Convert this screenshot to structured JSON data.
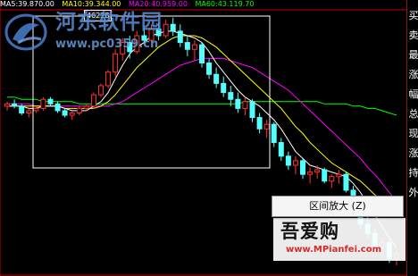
{
  "ma_header": {
    "items": [
      {
        "text": "MA5:39.870.00",
        "color": "#ffffff"
      },
      {
        "text": "MA10:39.344.00",
        "color": "#ffff00"
      },
      {
        "text": "MA20:40.959.00",
        "color": "#ff00ff"
      },
      {
        "text": "MA60:43.119.70",
        "color": "#00ff00"
      }
    ]
  },
  "selection_value": "46228",
  "right_panel": {
    "items": [
      "买",
      "卖",
      "最",
      "涨",
      "幅",
      "总",
      "现",
      "涨",
      "持",
      "外"
    ]
  },
  "context_menu": {
    "item_label": "区间放大 (Z)"
  },
  "watermarks": {
    "top_title": "河东软件园",
    "top_url": "www.pc0359.cn",
    "bottom_brand": "吾爱购",
    "bottom_url": "www.MPianfei.com"
  },
  "colors": {
    "background": "#000000",
    "up_candle": "#ff3232",
    "down_candle": "#54ffff",
    "ma5": "#ffffff",
    "ma10": "#ffff00",
    "ma20": "#ff00ff",
    "ma60": "#00ff00",
    "selection_box": "#ffffff",
    "separator": "#c00000"
  },
  "chart_data": {
    "type": "candlestick",
    "candles": [
      [
        100,
        102,
        98,
        101
      ],
      [
        101,
        103,
        99,
        100
      ],
      [
        100,
        101,
        96,
        97
      ],
      [
        97,
        99,
        95,
        98
      ],
      [
        98,
        100,
        97,
        99
      ],
      [
        99,
        104,
        98,
        103
      ],
      [
        103,
        104,
        100,
        101
      ],
      [
        101,
        102,
        97,
        98
      ],
      [
        98,
        99,
        95,
        96
      ],
      [
        96,
        98,
        94,
        97
      ],
      [
        97,
        100,
        96,
        99
      ],
      [
        99,
        101,
        98,
        100
      ],
      [
        100,
        106,
        99,
        105
      ],
      [
        105,
        110,
        104,
        109
      ],
      [
        109,
        116,
        108,
        115
      ],
      [
        115,
        125,
        113,
        123
      ],
      [
        123,
        130,
        120,
        128
      ],
      [
        128,
        131,
        121,
        124
      ],
      [
        124,
        133,
        123,
        131
      ],
      [
        131,
        135,
        127,
        129
      ],
      [
        129,
        136,
        128,
        134
      ],
      [
        134,
        137,
        129,
        131
      ],
      [
        131,
        138,
        130,
        136
      ],
      [
        136,
        139,
        131,
        133
      ],
      [
        133,
        136,
        126,
        128
      ],
      [
        128,
        131,
        122,
        125
      ],
      [
        125,
        129,
        120,
        127
      ],
      [
        127,
        128,
        117,
        119
      ],
      [
        119,
        121,
        112,
        114
      ],
      [
        114,
        117,
        108,
        110
      ],
      [
        110,
        113,
        104,
        106
      ],
      [
        106,
        109,
        100,
        103
      ],
      [
        103,
        106,
        97,
        99
      ],
      [
        99,
        104,
        96,
        102
      ],
      [
        102,
        103,
        93,
        95
      ],
      [
        95,
        97,
        88,
        90
      ],
      [
        90,
        94,
        86,
        92
      ],
      [
        92,
        93,
        82,
        84
      ],
      [
        84,
        86,
        76,
        78
      ],
      [
        78,
        80,
        72,
        74
      ],
      [
        74,
        78,
        70,
        76
      ],
      [
        76,
        77,
        68,
        70
      ],
      [
        70,
        73,
        66,
        71
      ],
      [
        71,
        74,
        68,
        72
      ],
      [
        72,
        73,
        66,
        67
      ],
      [
        67,
        70,
        64,
        69
      ],
      [
        69,
        72,
        66,
        70
      ],
      [
        70,
        71,
        62,
        63
      ],
      [
        63,
        65,
        54,
        56
      ],
      [
        56,
        58,
        46,
        48
      ],
      [
        48,
        52,
        42,
        44
      ],
      [
        44,
        46,
        36,
        38
      ],
      [
        38,
        42,
        33,
        40
      ],
      [
        40,
        41,
        31,
        33
      ],
      [
        33,
        37,
        30,
        35
      ]
    ],
    "ma5": [
      100,
      100,
      100,
      99,
      99,
      100,
      100,
      100,
      99,
      98,
      98,
      98,
      100,
      102,
      106,
      112,
      118,
      123,
      126,
      128,
      131,
      132,
      133,
      133,
      132,
      131,
      130,
      128,
      124,
      119,
      115,
      111,
      107,
      104,
      102,
      100,
      97,
      94,
      90,
      85,
      80,
      77,
      74,
      73,
      72,
      71,
      70,
      69,
      66,
      62,
      57,
      52,
      47,
      42,
      38
    ],
    "ma10": [
      100,
      100,
      100,
      100,
      100,
      100,
      100,
      100,
      99,
      99,
      99,
      99,
      99,
      100,
      102,
      105,
      109,
      113,
      117,
      120,
      123,
      126,
      128,
      130,
      131,
      131,
      131,
      130,
      128,
      126,
      123,
      120,
      117,
      114,
      111,
      108,
      105,
      102,
      99,
      95,
      91,
      88,
      84,
      81,
      78,
      75,
      73,
      71,
      69,
      67,
      64,
      61,
      58,
      55,
      52
    ],
    "ma20": [
      101,
      101,
      101,
      101,
      100,
      100,
      100,
      100,
      100,
      100,
      100,
      100,
      100,
      100,
      100,
      101,
      102,
      104,
      106,
      108,
      110,
      112,
      114,
      116,
      118,
      119,
      120,
      121,
      121,
      121,
      121,
      120,
      119,
      118,
      117,
      115,
      113,
      111,
      109,
      107,
      104,
      101,
      98,
      95,
      92,
      89,
      86,
      83,
      80,
      77,
      73,
      70,
      66,
      62,
      58
    ],
    "ma60": [
      104,
      104,
      103,
      103,
      103,
      102,
      102,
      102,
      102,
      102,
      101,
      101,
      101,
      101,
      101,
      101,
      101,
      101,
      101,
      101,
      101,
      101,
      101,
      101,
      101,
      101,
      101,
      101,
      101,
      101,
      101,
      101,
      101,
      102,
      102,
      102,
      102,
      102,
      102,
      102,
      102,
      102,
      102,
      102,
      101,
      101,
      101,
      101,
      100,
      100,
      99,
      99,
      98,
      97,
      96
    ],
    "grid": false
  }
}
